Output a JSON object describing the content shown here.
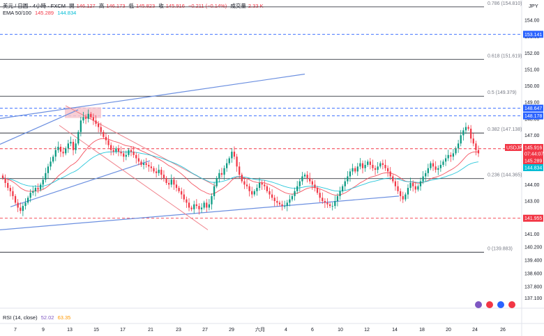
{
  "header": {
    "symbol": "美元 / 日圓 · 4小時 · FXCM",
    "open_label": "開",
    "open": "146.127",
    "high_label": "高",
    "high": "146.173",
    "low_label": "低",
    "low": "145.823",
    "close_label": "收",
    "close": "145.916",
    "change": "−0.211 (−0.14%)",
    "volume_label": "成交量",
    "volume": "2.33 K",
    "ema_label": "EMA 50/100",
    "ema50": "145.289",
    "ema100": "144.834",
    "rsi_label": "RSI (14, close)",
    "rsi_value": "52.02",
    "rsi_ma": "63.35"
  },
  "axis": {
    "currency": "JPY"
  },
  "colors": {
    "up": "#089981",
    "down": "#f23645",
    "ema50": "#f23645",
    "ema100": "#00bcd4",
    "channel": "#5b84e0",
    "fib": "#131722",
    "level_blue": "#2962ff"
  },
  "chart_data": {
    "type": "candlestick",
    "title": "",
    "x_ticks": [
      "7",
      "9",
      "13",
      "15",
      "17",
      "21",
      "23",
      "27",
      "29",
      "六月",
      "4",
      "6",
      "10",
      "12",
      "14",
      "18",
      "20",
      "24",
      "26"
    ],
    "y_ticks": [
      136.4,
      137.1,
      137.8,
      138.6,
      139.4,
      140.2,
      141.0,
      141.9,
      143.0,
      144.0,
      145.0,
      146.0,
      147.0,
      148.0,
      149.0,
      150.0,
      151.0,
      152.0,
      153.0,
      154.0
    ],
    "ylim": [
      136.0,
      155.5
    ],
    "fib_levels": [
      {
        "ratio": "0.786",
        "price": 154.81,
        "label": "0.786 (154.810)"
      },
      {
        "ratio": "0.618",
        "price": 151.619,
        "label": "0.618 (151.619)"
      },
      {
        "ratio": "0.5",
        "price": 149.379,
        "label": "0.5 (149.379)"
      },
      {
        "ratio": "0.382",
        "price": 147.138,
        "label": "0.382 (147.138)"
      },
      {
        "ratio": "0.236",
        "price": 144.365,
        "label": "0.236 (144.365)"
      },
      {
        "ratio": "0",
        "price": 139.883,
        "label": "0 (139.883)"
      }
    ],
    "price_tags": [
      {
        "label": "153.141",
        "price": 153.141,
        "color": "#2962ff"
      },
      {
        "label": "148.647",
        "price": 148.647,
        "color": "#2962ff"
      },
      {
        "label": "148.178",
        "price": 148.178,
        "color": "#2962ff"
      },
      {
        "label": "146.184",
        "price": 146.184,
        "color": "#f23645"
      },
      {
        "label": "USDJPY",
        "price": 145.916,
        "color": "#f23645"
      },
      {
        "label": "145.916",
        "price": 145.916,
        "color": "#f23645"
      },
      {
        "label": "07:44:07",
        "price": 145.916,
        "color": "#f23645"
      },
      {
        "label": "145.289",
        "price": 145.289,
        "color": "#f23645"
      },
      {
        "label": "144.834",
        "price": 144.834,
        "color": "#00bcd4"
      },
      {
        "label": "141.955",
        "price": 141.955,
        "color": "#f23645"
      }
    ],
    "dashed_levels": [
      {
        "price": 153.141,
        "color": "#2962ff"
      },
      {
        "price": 148.647,
        "color": "#2962ff"
      },
      {
        "price": 148.178,
        "color": "#2962ff"
      },
      {
        "price": 146.184,
        "color": "#f23645"
      },
      {
        "price": 141.955,
        "color": "#f23645"
      }
    ],
    "closes": [
      144.4,
      144.1,
      143.8,
      143.6,
      143.3,
      142.9,
      142.6,
      142.4,
      142.7,
      142.9,
      143.2,
      143.5,
      143.6,
      143.8,
      143.7,
      144.0,
      144.3,
      144.7,
      145.1,
      145.4,
      145.7,
      146.1,
      146.3,
      146.0,
      145.9,
      146.2,
      146.5,
      146.6,
      146.1,
      146.5,
      147.2,
      147.9,
      148.1,
      148.0,
      148.3,
      148.1,
      147.9,
      147.7,
      147.5,
      147.2,
      146.9,
      146.7,
      146.4,
      146.1,
      146.0,
      146.2,
      146.0,
      145.9,
      145.7,
      145.8,
      146.1,
      146.0,
      145.8,
      145.6,
      145.4,
      145.2,
      145.3,
      145.2,
      145.1,
      145.0,
      144.8,
      144.7,
      144.9,
      144.6,
      144.4,
      144.1,
      144.0,
      144.3,
      144.0,
      143.8,
      143.6,
      143.4,
      143.1,
      142.9,
      142.6,
      142.5,
      142.8,
      142.7,
      142.5,
      142.6,
      142.9,
      142.6,
      142.8,
      143.3,
      143.9,
      144.4,
      144.7,
      144.6,
      145.0,
      145.3,
      145.6,
      146.0,
      145.7,
      145.1,
      144.6,
      144.2,
      144.0,
      143.9,
      143.6,
      143.4,
      143.6,
      143.8,
      144.1,
      144.0,
      143.9,
      143.6,
      143.4,
      143.2,
      143.0,
      142.9,
      142.8,
      142.7,
      142.7,
      142.9,
      143.1,
      143.3,
      143.6,
      143.9,
      144.2,
      144.5,
      144.6,
      144.4,
      144.2,
      144.0,
      143.8,
      143.5,
      143.2,
      143.0,
      142.9,
      142.8,
      142.7,
      142.7,
      143.0,
      143.3,
      143.6,
      143.9,
      144.2,
      144.5,
      144.8,
      145.0,
      144.8,
      145.1,
      145.3,
      145.0,
      145.2,
      145.4,
      145.2,
      145.0,
      144.9,
      145.1,
      145.3,
      145.2,
      145.0,
      144.8,
      144.5,
      144.2,
      143.9,
      143.6,
      143.3,
      143.1,
      143.4,
      143.8,
      144.1,
      143.9,
      143.7,
      143.9,
      144.2,
      144.5,
      144.7,
      145.0,
      145.3,
      145.1,
      144.9,
      145.0,
      145.2,
      145.4,
      145.6,
      145.8,
      145.7,
      145.9,
      146.2,
      146.5,
      147.0,
      147.3,
      147.5,
      147.4,
      146.8,
      146.5,
      146.1,
      145.9
    ]
  }
}
